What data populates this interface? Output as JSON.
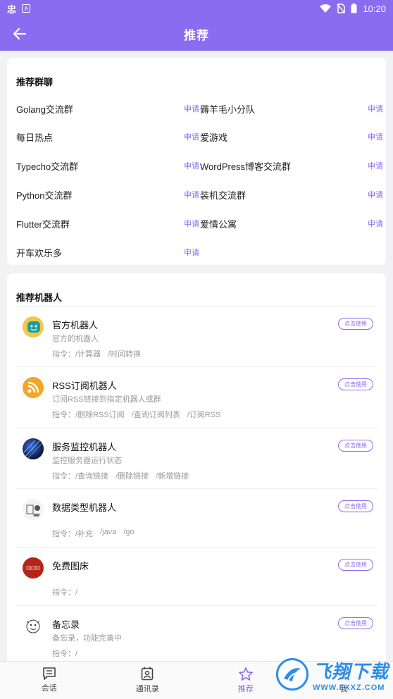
{
  "status": {
    "time": "10:20",
    "left_glyph": "忠",
    "left_box": "A"
  },
  "header": {
    "title": "推荐"
  },
  "groups": {
    "title": "推荐群聊",
    "apply_label": "申请",
    "items": [
      {
        "name": "Golang交流群"
      },
      {
        "name": "薅羊毛小分队"
      },
      {
        "name": "每日热点"
      },
      {
        "name": "爱游戏"
      },
      {
        "name": "Typecho交流群"
      },
      {
        "name": "WordPress博客交流群"
      },
      {
        "name": "Python交流群"
      },
      {
        "name": "装机交流群"
      },
      {
        "name": "Flutter交流群"
      },
      {
        "name": "爱情公寓"
      },
      {
        "name": "开车欢乐多"
      }
    ]
  },
  "bots": {
    "title": "推荐机器人",
    "use_label": "点击使用",
    "cmd_prefix": "指令：",
    "items": [
      {
        "name": "官方机器人",
        "desc": "官方的机器人",
        "cmds": [
          "/计算器",
          "/时间转换"
        ],
        "avatar": "mascot-avatar"
      },
      {
        "name": "RSS订阅机器人",
        "desc": "订阅RSS链接到指定机器人或群",
        "cmds": [
          "/删除RSS订阅",
          "/查询订阅列表",
          "/订阅RSS"
        ],
        "avatar": "rss-avatar"
      },
      {
        "name": "服务监控机器人",
        "desc": "监控服务器运行状态",
        "cmds": [
          "/查询链接",
          "/删除链接",
          "/新增链接"
        ],
        "avatar": "starfield-avatar"
      },
      {
        "name": "数据类型机器人",
        "desc": "",
        "cmds": [
          "/补充",
          "/java",
          "/go"
        ],
        "avatar": "sketch-avatar"
      },
      {
        "name": "免费图床",
        "desc": "",
        "cmds": [
          "/"
        ],
        "avatar": "red-seal-avatar"
      },
      {
        "name": "备忘录",
        "desc": "备忘录，功能完善中",
        "cmds": [
          "/"
        ],
        "avatar": "doodle-avatar"
      }
    ]
  },
  "tabs": [
    {
      "label": "会话",
      "icon": "chat-icon"
    },
    {
      "label": "通讯录",
      "icon": "contacts-icon"
    },
    {
      "label": "推荐",
      "icon": "star-icon",
      "active": true
    },
    {
      "label": "我",
      "icon": "person-icon"
    }
  ],
  "watermark": {
    "main": "飞翔下载",
    "sub": "WWW.FXXZ.COM"
  },
  "colors": {
    "accent": "#8a6cf0",
    "rss": "#f5a623"
  }
}
